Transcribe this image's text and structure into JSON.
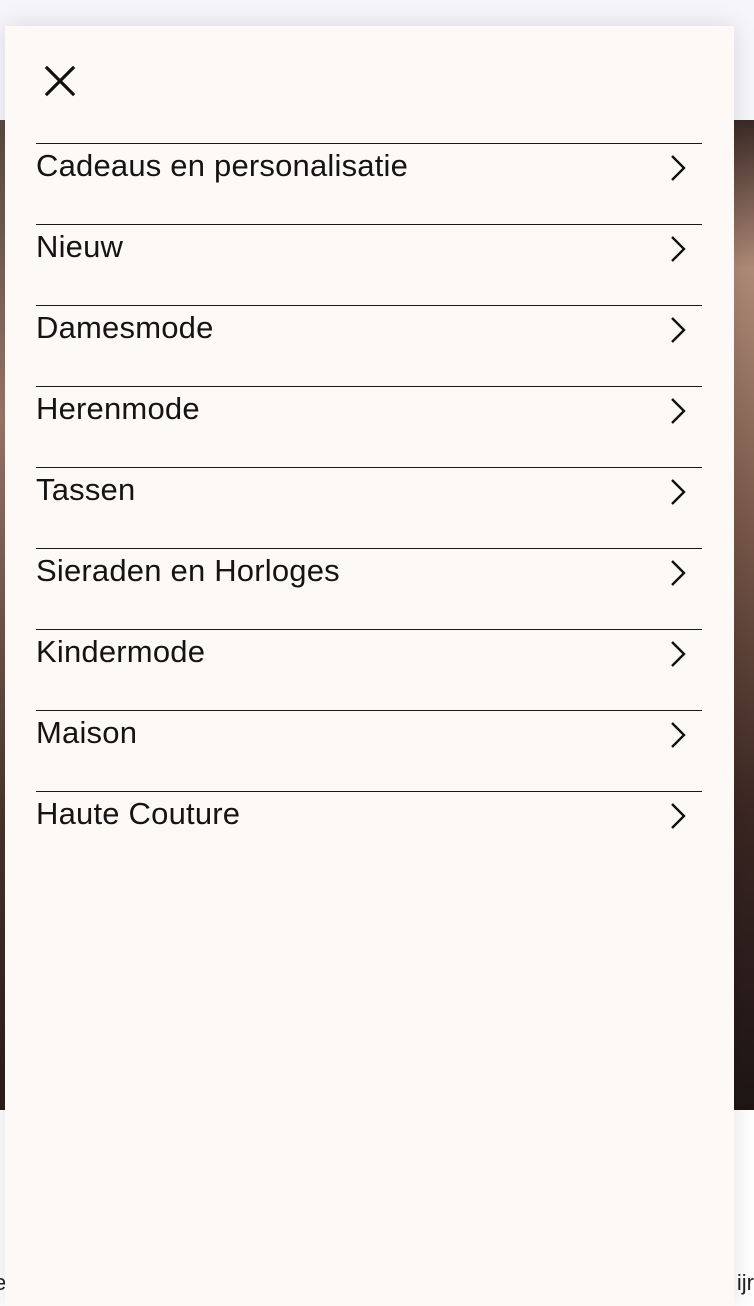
{
  "drawer": {
    "close_icon": "close-icon",
    "menu_items": [
      {
        "label": "Cadeaus en personalisatie",
        "icon": "chevron-right-icon"
      },
      {
        "label": "Nieuw",
        "icon": "chevron-right-icon"
      },
      {
        "label": "Damesmode",
        "icon": "chevron-right-icon"
      },
      {
        "label": "Herenmode",
        "icon": "chevron-right-icon"
      },
      {
        "label": "Tassen",
        "icon": "chevron-right-icon"
      },
      {
        "label": "Sieraden en Horloges",
        "icon": "chevron-right-icon"
      },
      {
        "label": "Kindermode",
        "icon": "chevron-right-icon"
      },
      {
        "label": "Maison",
        "icon": "chevron-right-icon"
      },
      {
        "label": "Haute Couture",
        "icon": "chevron-right-icon"
      }
    ]
  },
  "background": {
    "footer_left_text": "e",
    "footer_right_text": "ijr"
  },
  "colors": {
    "drawer_bg": "#fdf9f7",
    "divider": "#1a1a1a",
    "text": "#141414"
  }
}
